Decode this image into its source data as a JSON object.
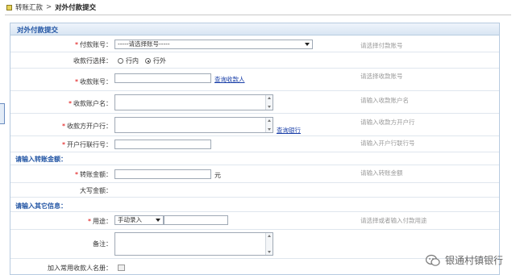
{
  "breadcrumb": {
    "parent": "转账汇款",
    "separator": ">",
    "current": "对外付款提交"
  },
  "panel": {
    "title": "对外付款提交"
  },
  "form": {
    "pay_account": {
      "label": "付款账号：",
      "selected": "-----请选择账号-----",
      "hint": "请选择付款账号"
    },
    "receive_bank": {
      "label": "收款行选择：",
      "option_in": "行内",
      "option_out": "行外",
      "selected": "行外"
    },
    "receive_account": {
      "label": "收款账号：",
      "value": "",
      "link": "查询收款人",
      "hint": "请选择收款账号"
    },
    "receive_name": {
      "label": "收款账户名：",
      "value": "",
      "hint": "请输入收款账户名"
    },
    "receive_bank_name": {
      "label": "收款方开户行：",
      "value": "",
      "link": "查询银行",
      "hint": "请输入收款方开户行"
    },
    "bank_number": {
      "label": "开户行联行号：",
      "value": "",
      "hint": "请输入开户行联行号"
    }
  },
  "section_amount": {
    "title": "请输入转账金额："
  },
  "amount": {
    "amount": {
      "label": "转账金额：",
      "value": "",
      "unit": "元",
      "hint": "请输入转账金额"
    },
    "capital": {
      "label": "大写金额：",
      "value": ""
    }
  },
  "section_other": {
    "title": "请输入其它信息："
  },
  "other": {
    "purpose": {
      "label": "用途：",
      "selected": "手动录入",
      "value": "",
      "hint": "请选择或者输入付款用途"
    },
    "remark": {
      "label": "备注：",
      "value": ""
    },
    "add_payee": {
      "label": "加入常用收款人名册："
    }
  },
  "watermark": {
    "text": "银通村镇银行"
  },
  "colors": {
    "section_title": "#2255a4",
    "required": "#dd0000",
    "hint": "#9a9a9a",
    "link": "#1a3fa8"
  }
}
